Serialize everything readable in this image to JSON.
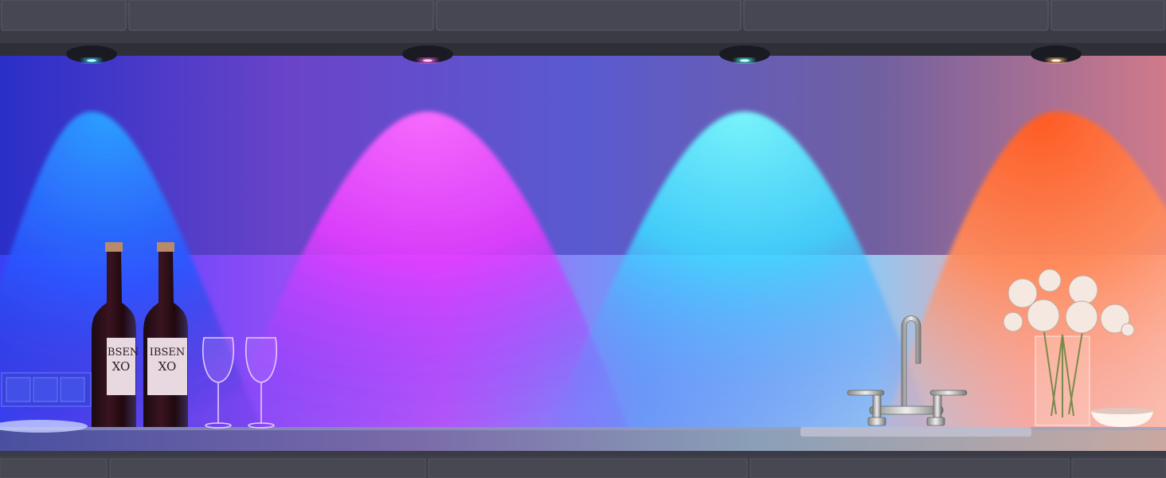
{
  "scene": {
    "colors": {
      "wall": "#4a4870",
      "cabinet": "#3c3d47",
      "counter": "#5a5c66",
      "light_blue": "#2f8cff",
      "light_magenta": "#ff4df2",
      "light_cyan": "#5ff5ff",
      "light_orange": "#ff6a2a"
    },
    "lights": [
      {
        "name": "blue",
        "indicator_color": "#39c6ff"
      },
      {
        "name": "magenta",
        "indicator_color": "#ff5cf0"
      },
      {
        "name": "cyan",
        "indicator_color": "#3ff7e6"
      },
      {
        "name": "orange",
        "indicator_color": "#ffb36a"
      }
    ],
    "bottle_label": {
      "brand": "IBSEN",
      "line": "XO"
    }
  }
}
